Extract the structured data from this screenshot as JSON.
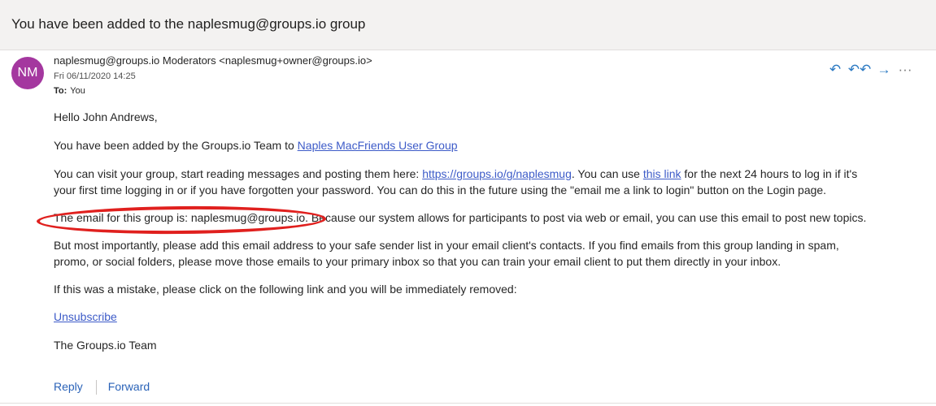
{
  "email": {
    "subject": "You have been added to the naplesmug@groups.io group",
    "avatar_initials": "NM",
    "sender": "naplesmug@groups.io Moderators <naplesmug+owner@groups.io>",
    "date": "Fri 06/11/2020 14:25",
    "to_label": "To:",
    "to_value": "You",
    "actions": [
      {
        "name": "reply-icon",
        "glyph": "↶"
      },
      {
        "name": "reply-all-icon",
        "glyph": "↶↶"
      },
      {
        "name": "forward-icon",
        "glyph": "→"
      },
      {
        "name": "more-icon",
        "glyph": "···"
      }
    ]
  },
  "body": {
    "greeting": "Hello John Andrews,",
    "added_prefix": "You have been added by the Groups.io Team to ",
    "group_link": "Naples MacFriends User Group",
    "visit_prefix": "You can visit your group, start reading messages and posting them here: ",
    "group_url": "https://groups.io/g/naplesmug",
    "visit_mid": ". You can use ",
    "this_link": "this link",
    "visit_suffix": " for the next 24 hours to log in if it's",
    "visit_line2": "your first time logging in or if you have forgotten your password. You can do this in the future using the \"email me a link to login\" button on the Login page.",
    "email_para": "The email for this group is: naplesmug@groups.io. Because our system allows for participants to post via web or email, you can use this email to post new topics.",
    "important_line1": "But most importantly, please add this email address to your safe sender list in your email client's contacts. If you find emails from this group landing in spam,",
    "important_line2": "promo, or social folders, please move those emails to your primary inbox so that you can train your email client to put them directly in your inbox.",
    "mistake": "If this was a mistake, please click on the following link and you will be immediately removed:",
    "unsubscribe": "Unsubscribe",
    "signature": "The Groups.io Team"
  },
  "footer": {
    "reply": "Reply",
    "forward": "Forward"
  },
  "colors": {
    "link": "#3d5bc8",
    "avatar": "#a4379f",
    "highlight_circle": "#e0201e"
  }
}
